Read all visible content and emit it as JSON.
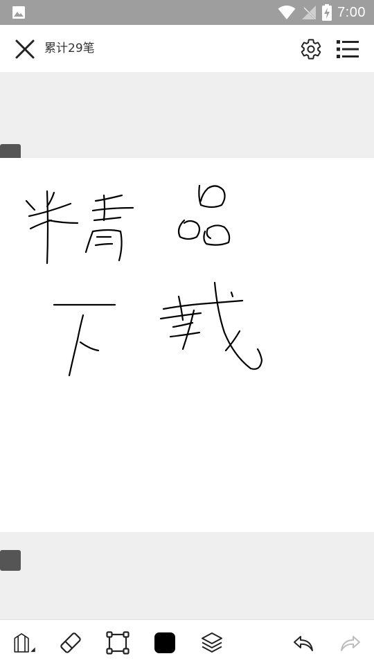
{
  "status_bar": {
    "time": "7:00",
    "icons": [
      "gallery-icon",
      "wifi-icon",
      "no-signal-icon",
      "battery-charging-icon"
    ]
  },
  "app_bar": {
    "stroke_count_label": "累计29笔",
    "icons": [
      "close-icon",
      "settings-gear-icon",
      "menu-list-icon"
    ]
  },
  "toolbar": {
    "tools": [
      "pen-icon",
      "eraser-icon",
      "select-icon",
      "color-swatch",
      "layers-icon",
      "undo-icon",
      "redo-icon"
    ],
    "current_color": "#000000",
    "redo_enabled": false
  },
  "colors": {
    "status_bar": "#9e9e9e",
    "canvas_background": "#efefef",
    "page_background": "#ffffff",
    "handle": "#555555",
    "icon": "#222222",
    "disabled_icon": "#bdbdbd"
  }
}
